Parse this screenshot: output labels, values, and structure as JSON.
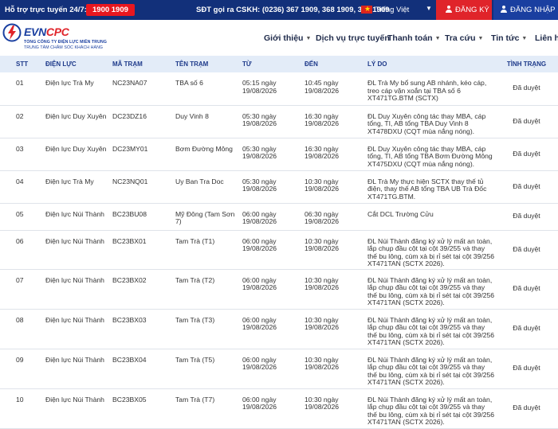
{
  "topbar": {
    "hotline_label": "Hỗ trợ trực tuyến 24/7:",
    "hotline_number": "1900 1909",
    "cskh_label": "SĐT gọi ra CSKH:",
    "cskh_numbers": "(0236) 367 1909, 368 1909, 369 1909",
    "language": "Tiếng Việt",
    "register_label": "ĐĂNG KÝ",
    "login_label": "ĐĂNG NHẬP",
    "register_color": "#e0242a",
    "login_color": "#1a3fa0"
  },
  "header": {
    "logo_evn": "EVN",
    "logo_cpc": "CPC",
    "logo_line1": "TỔNG CÔNG TY ĐIỆN LỰC MIỀN TRUNG",
    "logo_line2": "TRUNG TÂM CHĂM SÓC KHÁCH HÀNG",
    "nav": [
      "Giới thiệu",
      "Dịch vụ trực tuyến",
      "Thanh toán",
      "Tra cứu",
      "Tin tức",
      "Liên hệ"
    ]
  },
  "table": {
    "headers": [
      "STT",
      "ĐIỆN LỰC",
      "MÃ TRẠM",
      "TÊN TRẠM",
      "TỪ",
      "ĐẾN",
      "LÝ DO",
      "TÌNH TRẠNG"
    ],
    "rows": [
      {
        "stt": "01",
        "dien_luc": "Điện lực Trà My",
        "ma_tram": "NC23NA07",
        "ten_tram": "TBA số 6",
        "tu": "05:15 ngày 19/08/2026",
        "den": "10:45 ngày 19/08/2026",
        "ly_do": "ĐL Trà My bổ sung AB nhánh, kéo cáp, treo cáp vặn xoắn tại TBA số 6 XT471TG.BTM (SCTX)",
        "tinh_trang": "Đã duyệt"
      },
      {
        "stt": "02",
        "dien_luc": "Điện lực Duy Xuyên",
        "ma_tram": "DC23DZ16",
        "ten_tram": "Duy Vinh 8",
        "tu": "05:30 ngày 19/08/2026",
        "den": "16:30 ngày 19/08/2026",
        "ly_do": "ĐL Duy Xuyên công tác thay MBA, cáp tổng, TI, AB tổng TBA Duy Vinh 8 XT478DXU (CQT mùa nắng nóng).",
        "tinh_trang": "Đã duyệt"
      },
      {
        "stt": "03",
        "dien_luc": "Điện lực Duy Xuyên",
        "ma_tram": "DC23MY01",
        "ten_tram": "Bơm Đường Mông",
        "tu": "05:30 ngày 19/08/2026",
        "den": "16:30 ngày 19/08/2026",
        "ly_do": "ĐL Duy Xuyên công tác thay MBA, cáp tổng, TI, AB tổng TBA Bơm Đường Mông XT475DXU (CQT mùa nắng nóng).",
        "tinh_trang": "Đã duyệt"
      },
      {
        "stt": "04",
        "dien_luc": "Điện lực Trà My",
        "ma_tram": "NC23NQ01",
        "ten_tram": "Uy Ban Tra Doc",
        "tu": "05:30 ngày 19/08/2026",
        "den": "10:30 ngày 19/08/2026",
        "ly_do": "ĐL Trà My thực hiện SCTX thay thế tủ điện, thay thế AB tổng TBA UB Trà Đốc XT471TG.BTM.",
        "tinh_trang": "Đã duyệt"
      },
      {
        "stt": "05",
        "dien_luc": "Điện lực Núi Thành",
        "ma_tram": "BC23BU08",
        "ten_tram": "Mỹ Đông (Tam Sơn 7)",
        "tu": "06:00 ngày 19/08/2026",
        "den": "06:30 ngày 19/08/2026",
        "ly_do": "Cắt DCL Trường Cửu",
        "tinh_trang": "Đã duyệt"
      },
      {
        "stt": "06",
        "dien_luc": "Điện lực Núi Thành",
        "ma_tram": "BC23BX01",
        "ten_tram": "Tam Trà (T1)",
        "tu": "06:00 ngày 19/08/2026",
        "den": "10:30 ngày 19/08/2026",
        "ly_do": "ĐL Núi Thành đăng ký xử lý mất an toàn, lắp chụp đầu cột tại cột 39/255 và thay thế bu lông, cùm xà bị rỉ sét tại cột 39/256 XT471TAN (SCTX 2026).",
        "tinh_trang": "Đã duyệt"
      },
      {
        "stt": "07",
        "dien_luc": "Điện lực Núi Thành",
        "ma_tram": "BC23BX02",
        "ten_tram": "Tam Trà (T2)",
        "tu": "06:00 ngày 19/08/2026",
        "den": "10:30 ngày 19/08/2026",
        "ly_do": "ĐL Núi Thành đăng ký xử lý mất an toàn, lắp chụp đầu cột tại cột 39/255 và thay thế bu lông, cùm xà bị rỉ sét tại cột 39/256 XT471TAN (SCTX 2026).",
        "tinh_trang": "Đã duyệt"
      },
      {
        "stt": "08",
        "dien_luc": "Điện lực Núi Thành",
        "ma_tram": "BC23BX03",
        "ten_tram": "Tam Trà (T3)",
        "tu": "06:00 ngày 19/08/2026",
        "den": "10:30 ngày 19/08/2026",
        "ly_do": "ĐL Núi Thành đăng ký xử lý mất an toàn, lắp chụp đầu cột tại cột 39/255 và thay thế bu lông, cùm xà bị rỉ sét tại cột 39/256 XT471TAN (SCTX 2026).",
        "tinh_trang": "Đã duyệt"
      },
      {
        "stt": "09",
        "dien_luc": "Điện lực Núi Thành",
        "ma_tram": "BC23BX04",
        "ten_tram": "Tam Trà (T5)",
        "tu": "06:00 ngày 19/08/2026",
        "den": "10:30 ngày 19/08/2026",
        "ly_do": "ĐL Núi Thành đăng ký xử lý mất an toàn, lắp chụp đầu cột tại cột 39/255 và thay thế bu lông, cùm xà bị rỉ sét tại cột 39/256 XT471TAN (SCTX 2026).",
        "tinh_trang": "Đã duyệt"
      },
      {
        "stt": "10",
        "dien_luc": "Điện lực Núi Thành",
        "ma_tram": "BC23BX05",
        "ten_tram": "Tam Trà (T7)",
        "tu": "06:00 ngày 19/08/2026",
        "den": "10:30 ngày 19/08/2026",
        "ly_do": "ĐL Núi Thành đăng ký xử lý mất an toàn, lắp chụp đầu cột tại cột 39/255 và thay thế bu lông, cùm xà bị rỉ sét tại cột 39/256 XT471TAN (SCTX 2026).",
        "tinh_trang": "Đã duyệt"
      }
    ]
  }
}
